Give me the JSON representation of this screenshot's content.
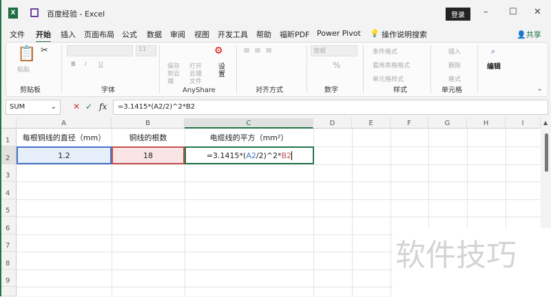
{
  "title": {
    "app_icon": "X",
    "doc": "百度经验",
    "sep": "-",
    "app": "Excel",
    "login": "登录",
    "min": "–",
    "max": "☐",
    "close": "✕"
  },
  "tabs": [
    "文件",
    "开始",
    "插入",
    "页面布局",
    "公式",
    "数据",
    "审阅",
    "视图",
    "开发工具",
    "帮助",
    "福昕PDF",
    "Power Pivot",
    "操作说明搜索"
  ],
  "share": "共享",
  "ribbon": {
    "clipboard": {
      "paste": "粘贴",
      "label": "剪贴板"
    },
    "font": {
      "size": "11",
      "label": "字体",
      "bold": "B",
      "italic": "I",
      "underline": "U"
    },
    "anyshare": {
      "save": "保存到云端",
      "open": "打开云端文件",
      "settings": "设置",
      "label": "AnyShare"
    },
    "alignment": {
      "label": "对齐方式"
    },
    "number": {
      "format": "常规",
      "percent": "%",
      "label": "数字"
    },
    "styles": {
      "cond": "条件格式",
      "table": "套用表格格式",
      "cell": "单元格样式",
      "label": "样式"
    },
    "cells": {
      "insert": "插入",
      "delete": "删除",
      "format": "格式",
      "label": "单元格"
    },
    "edit": {
      "label": "编辑"
    }
  },
  "formula_bar": {
    "name_box": "SUM",
    "cancel": "✕",
    "enter": "✓",
    "fx": "fx",
    "formula": "=3.1415*(A2/2)^2*B2"
  },
  "columns": [
    "A",
    "B",
    "C",
    "D",
    "E",
    "F",
    "G",
    "H",
    "I"
  ],
  "rows": [
    "1",
    "2",
    "3",
    "4",
    "5",
    "6",
    "7",
    "8",
    "9"
  ],
  "cells": {
    "A1": "每根铜线的直径（mm）",
    "B1": "铜线的根数",
    "C1": "电缆线的平方（mm²）",
    "A2": "1.2",
    "B2": "18",
    "C2_parts": [
      "=3.1415*(",
      "A2",
      "/2)^2*",
      "B2"
    ]
  },
  "watermark": "软件技巧",
  "colors": {
    "accent": "#217346",
    "ref_a": "#4472c4",
    "ref_b": "#c0504d"
  }
}
